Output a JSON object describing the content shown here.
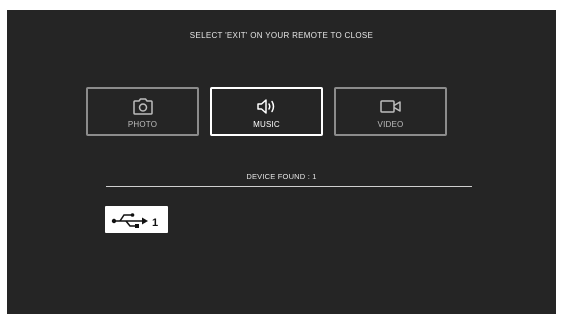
{
  "screen": {
    "hint": "SELECT 'EXIT' ON YOUR REMOTE TO CLOSE"
  },
  "media_tabs": [
    {
      "label": "PHOTO",
      "icon": "camera-icon",
      "selected": false
    },
    {
      "label": "MUSIC",
      "icon": "speaker-icon",
      "selected": true
    },
    {
      "label": "VIDEO",
      "icon": "video-camera-icon",
      "selected": false
    }
  ],
  "devices": {
    "found_label": "DEVICE FOUND : 1",
    "items": [
      {
        "number": "1",
        "icon": "usb-icon"
      }
    ]
  },
  "colors": {
    "background": "#252525",
    "selected_border": "#ffffff",
    "unselected_border": "#8c8c8c"
  }
}
